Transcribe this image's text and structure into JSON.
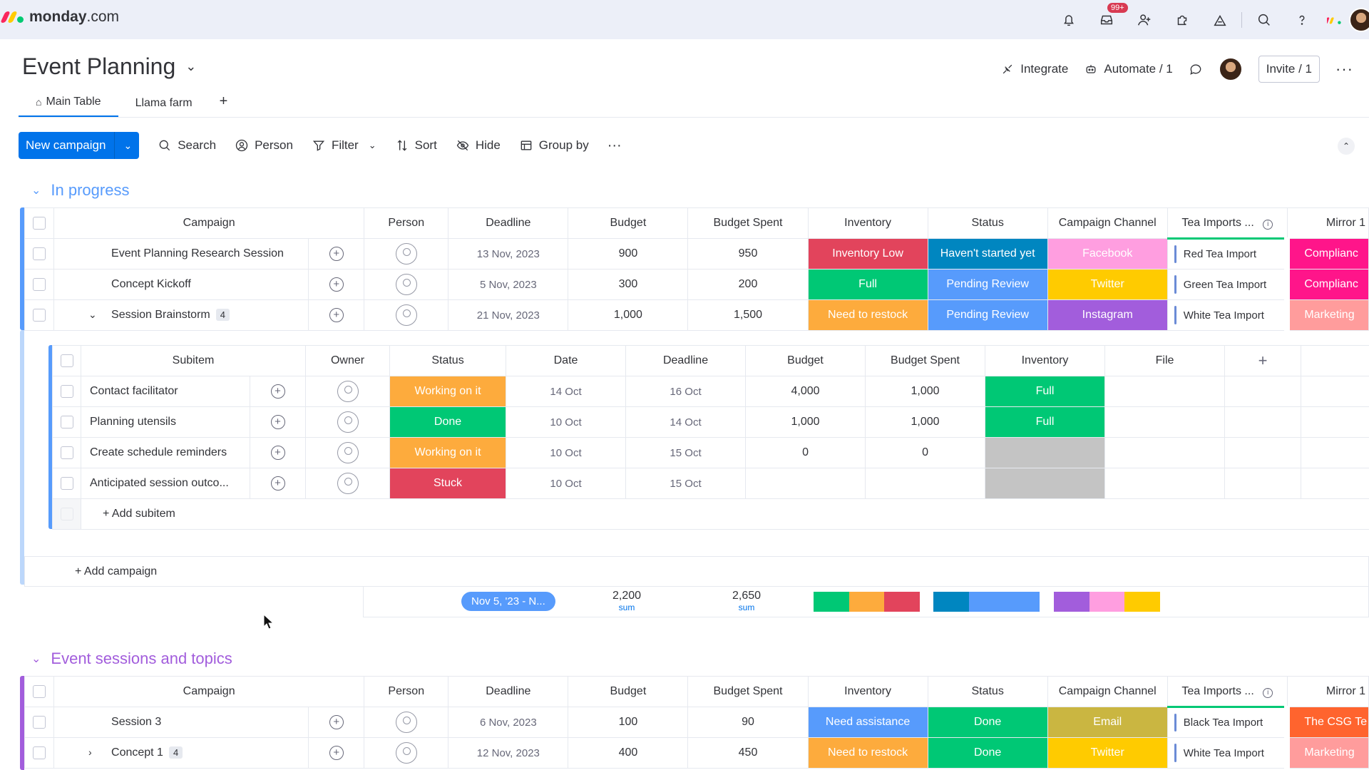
{
  "app": {
    "logo_bold": "monday",
    "logo_rest": ".com",
    "notif_badge": "99+"
  },
  "board": {
    "title": "Event Planning",
    "integrate": "Integrate",
    "automate": "Automate / 1",
    "invite": "Invite / 1"
  },
  "tabs": [
    {
      "label": "Main Table"
    },
    {
      "label": "Llama farm"
    },
    {
      "label": "+"
    }
  ],
  "toolbar": {
    "new_label": "New campaign",
    "search": "Search",
    "person": "Person",
    "filter": "Filter",
    "sort": "Sort",
    "hide": "Hide",
    "group_by": "Group by"
  },
  "columns": [
    "Campaign",
    "Person",
    "Deadline",
    "Budget",
    "Budget Spent",
    "Inventory",
    "Status",
    "Campaign Channel",
    "Tea Imports ...",
    "Mirror 1"
  ],
  "group1": {
    "title": "In progress",
    "color": "#579bfc",
    "rows": [
      {
        "name": "Event Planning Research Session",
        "deadline": "13 Nov, 2023",
        "budget": "900",
        "spent": "950",
        "inventory": "Inventory Low",
        "inv_color": "#e2445c",
        "status": "Haven't started yet",
        "st_color": "#0086c0",
        "channel": "Facebook",
        "ch_color": "#ff9ee0",
        "tea": "Red Tea Import",
        "mirror": "Complianc",
        "mi_color": "#ff158a",
        "count": ""
      },
      {
        "name": "Concept Kickoff",
        "deadline": "5 Nov, 2023",
        "budget": "300",
        "spent": "200",
        "inventory": "Full",
        "inv_color": "#00c875",
        "status": "Pending Review",
        "st_color": "#579bfc",
        "channel": "Twitter",
        "ch_color": "#ffcb00",
        "tea": "Green Tea Import",
        "mirror": "Complianc",
        "mi_color": "#ff158a",
        "count": ""
      },
      {
        "name": "Session Brainstorm",
        "deadline": "21 Nov, 2023",
        "budget": "1,000",
        "spent": "1,500",
        "inventory": "Need to restock",
        "inv_color": "#fdab3d",
        "status": "Pending Review",
        "st_color": "#579bfc",
        "channel": "Instagram",
        "ch_color": "#a25ddc",
        "tea": "White Tea Import",
        "mirror": "Marketing",
        "mi_color": "#ff7575",
        "count": "4"
      }
    ],
    "add": "+ Add campaign",
    "sum_date": "Nov 5, '23 - N...",
    "sum_budget": "2,200",
    "sum_spent": "2,650",
    "sum_label": "sum"
  },
  "subitems": {
    "columns": [
      "Subitem",
      "Owner",
      "Status",
      "Date",
      "Deadline",
      "Budget",
      "Budget Spent",
      "Inventory",
      "File",
      "+"
    ],
    "rows": [
      {
        "name": "Contact facilitator",
        "status": "Working on it",
        "st_color": "#fdab3d",
        "date": "14 Oct",
        "deadline": "16 Oct",
        "budget": "4,000",
        "spent": "1,000",
        "inventory": "Full",
        "inv_color": "#00c875"
      },
      {
        "name": "Planning utensils",
        "status": "Done",
        "st_color": "#00c875",
        "date": "10 Oct",
        "deadline": "14 Oct",
        "budget": "1,000",
        "spent": "1,000",
        "inventory": "Full",
        "inv_color": "#00c875"
      },
      {
        "name": "Create schedule reminders",
        "status": "Working on it",
        "st_color": "#fdab3d",
        "date": "10 Oct",
        "deadline": "15 Oct",
        "budget": "0",
        "spent": "0",
        "inventory": "",
        "inv_color": "#c4c4c4"
      },
      {
        "name": "Anticipated session outco...",
        "status": "Stuck",
        "st_color": "#e2445c",
        "date": "10 Oct",
        "deadline": "15 Oct",
        "budget": "",
        "spent": "",
        "inventory": "",
        "inv_color": "#c4c4c4"
      }
    ],
    "add": "+ Add subitem"
  },
  "group2": {
    "title": "Event sessions and topics",
    "color": "#a25ddc",
    "rows": [
      {
        "name": "Session 3",
        "deadline": "6 Nov, 2023",
        "budget": "100",
        "spent": "90",
        "inventory": "Need assistance",
        "inv_color": "#579bfc",
        "status": "Done",
        "st_color": "#00c875",
        "channel": "Email",
        "ch_color": "#cab641",
        "tea": "Black Tea Import",
        "mirror": "The CSG Te",
        "mi_color": "#ff642e",
        "count": ""
      },
      {
        "name": "Concept 1",
        "deadline": "12 Nov, 2023",
        "budget": "400",
        "spent": "450",
        "inventory": "Need to restock",
        "inv_color": "#fdab3d",
        "status": "Done",
        "st_color": "#00c875",
        "channel": "Twitter",
        "ch_color": "#ffcb00",
        "tea": "White Tea Import",
        "mirror": "Marketing",
        "mi_color": "#ff7575",
        "count": "4"
      }
    ]
  },
  "summary_colors": {
    "inventory": [
      "#00c875",
      "#fdab3d",
      "#e2445c"
    ],
    "status": [
      "#0086c0",
      "#579bfc",
      "#579bfc"
    ],
    "channel": [
      "#a25ddc",
      "#ff9ee0",
      "#ffcb00"
    ]
  }
}
